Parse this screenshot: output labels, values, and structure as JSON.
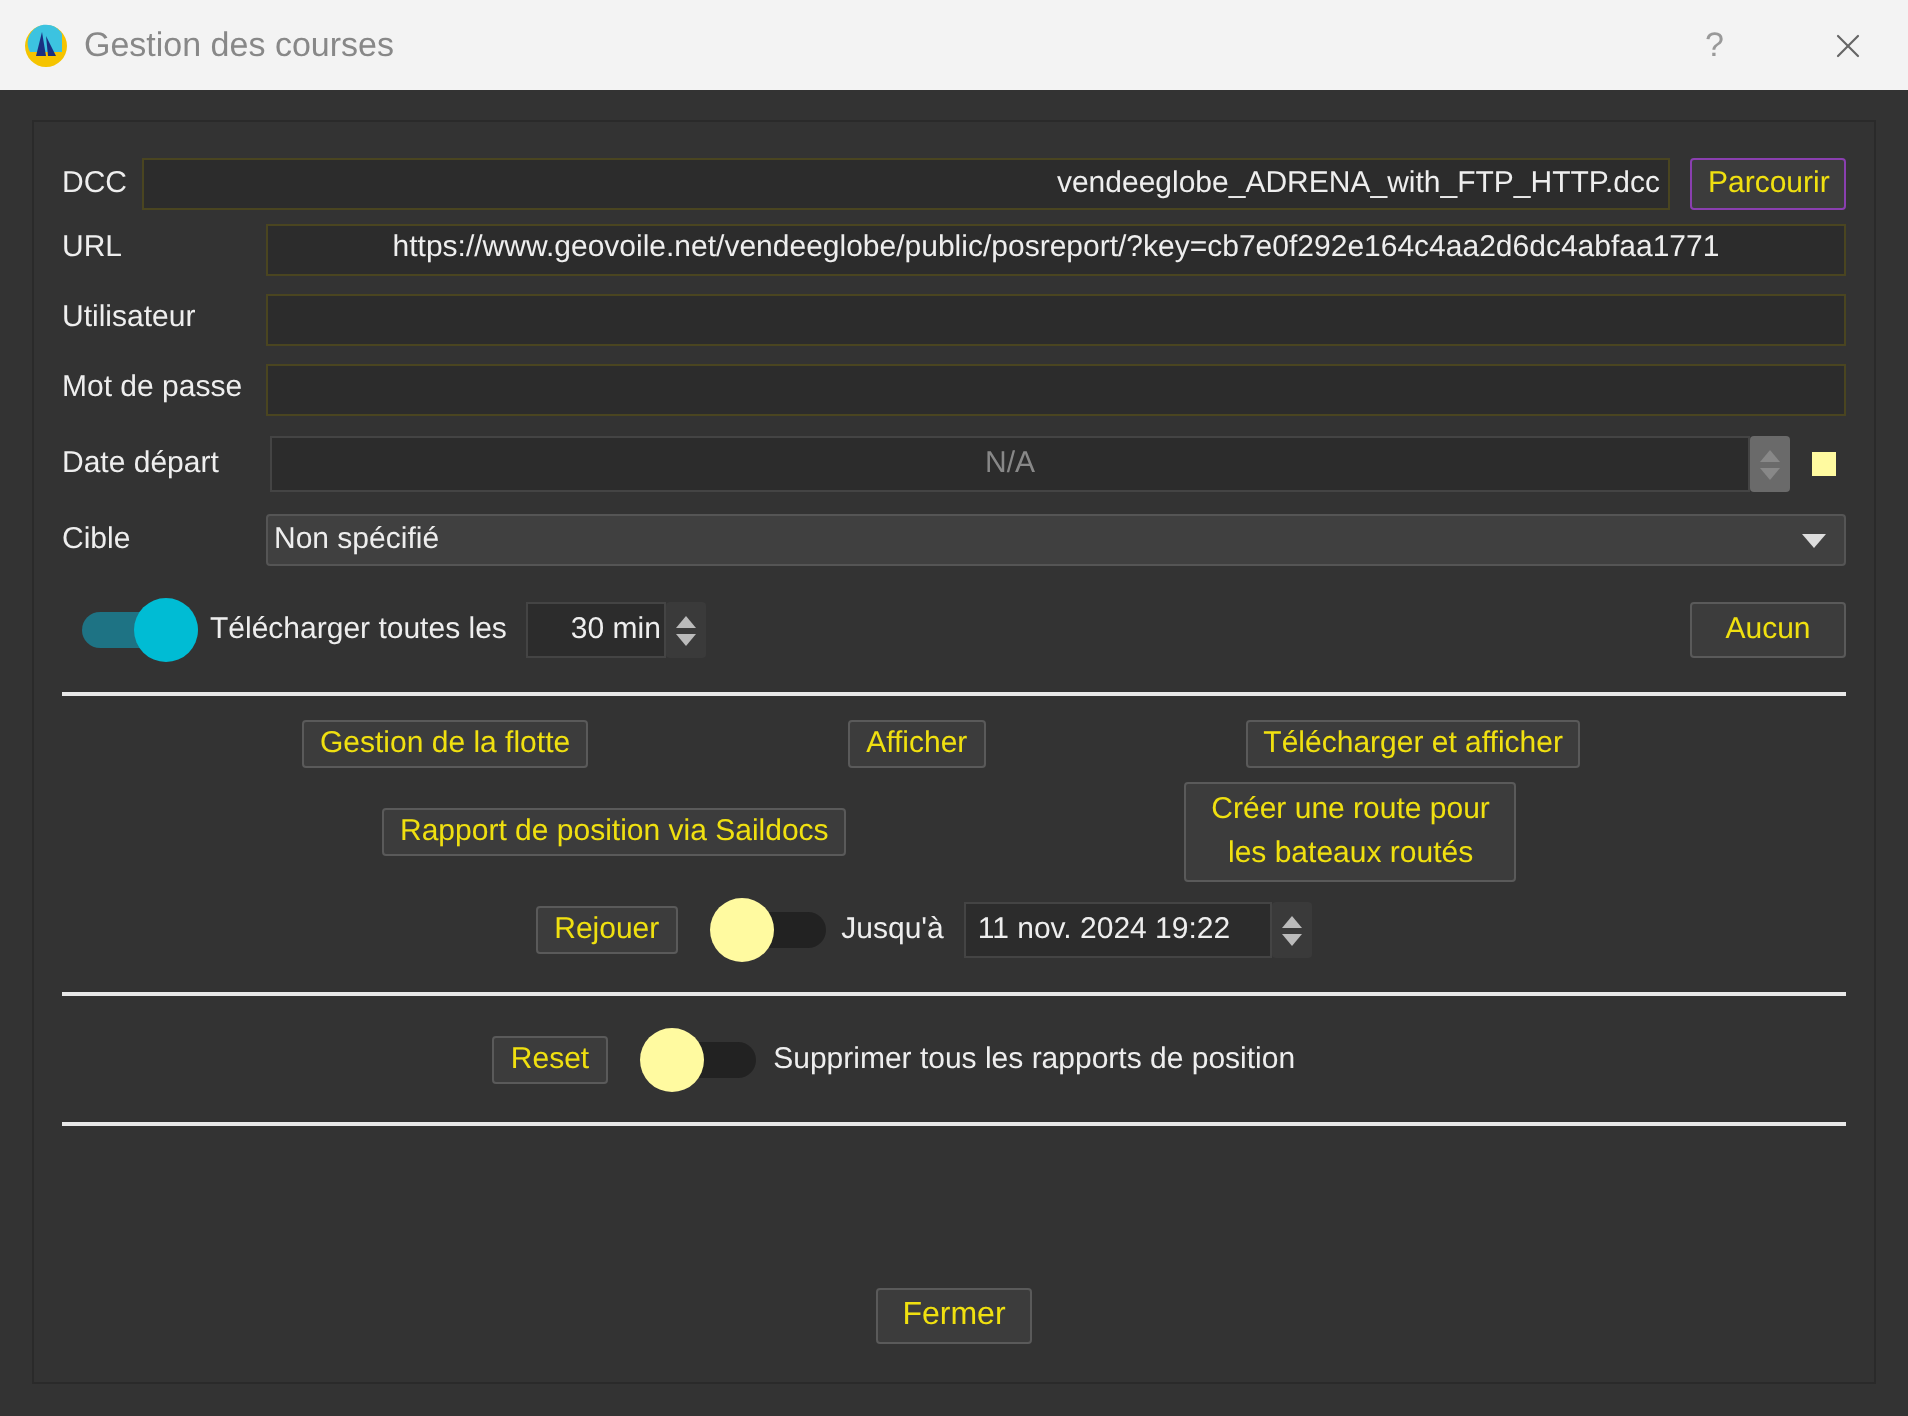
{
  "window": {
    "title": "Gestion des courses",
    "help": "?"
  },
  "dcc": {
    "label": "DCC",
    "value": "vendeeglobe_ADRENA_with_FTP_HTTP.dcc",
    "button": "Parcourir"
  },
  "fields": [
    {
      "label": "URL",
      "value": "https://www.geovoile.net/vendeeglobe/public/posreport/?key=cb7e0f292e164c4aa2d6dc4abfaa1771"
    },
    {
      "label": "Utilisateur"
    },
    {
      "label": "Mot de passe"
    }
  ],
  "start_date": {
    "label": "Date départ",
    "value": "N/A",
    "disabled": true
  },
  "target": {
    "label": "Cible",
    "value": "Non spécifié"
  },
  "download": {
    "on": true,
    "label": "Télécharger toutes les",
    "interval": "30 min",
    "button": "Aucun"
  },
  "actions_row_1": [
    "Gestion de la flotte",
    "Afficher",
    "Télécharger et afficher"
  ],
  "actions_row_2": [
    "Rapport de position via Saildocs",
    "Créer une route pour les bateaux routés"
  ],
  "replay": {
    "button": "Rejouer",
    "on": false,
    "label": "Jusqu'à",
    "until": "11 nov. 2024 19:22"
  },
  "reset": {
    "button": "Reset",
    "on": false,
    "label": "Supprimer tous les rapports de position"
  },
  "footer": {
    "button": "Fermer"
  }
}
